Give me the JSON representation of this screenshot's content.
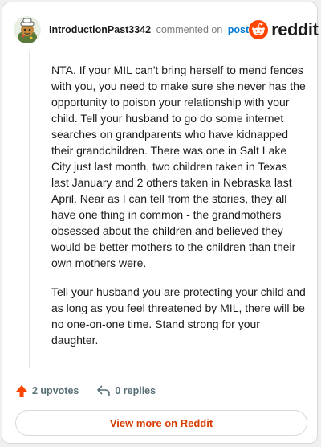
{
  "header": {
    "username": "IntroductionPast3342",
    "action_text": "commented on",
    "post_link": "post",
    "brand": "reddit",
    "avatar_icon": "avatar-icon",
    "brand_icon": "reddit-logo-icon"
  },
  "comment": {
    "paragraphs": [
      "NTA. If your MIL can't bring herself to mend fences with you, you need to make sure she never has the opportunity to poison your relationship with your child. Tell your husband to go do some internet searches on grandparents who have kidnapped their grandchildren. There was one in Salt Lake City just last month, two children taken in Texas last January and 2 others taken in Nebraska last April. Near as I can tell from the stories, they all have one thing in common - the grandmothers obsessed about the children and believed they would be better mothers to the children than their own mothers were.",
      "Tell your husband you are protecting your child and as long as you feel threatened by MIL, there will be no one-on-one time. Stand strong for your daughter."
    ]
  },
  "actions": {
    "upvotes": "2 upvotes",
    "replies": "0 replies",
    "upvote_icon": "upvote-arrow-icon",
    "reply_icon": "reply-icon"
  },
  "footer": {
    "view_more": "View more on Reddit"
  },
  "colors": {
    "accent": "#ff4500",
    "link": "#0079d3",
    "button_text": "#d93a00"
  }
}
